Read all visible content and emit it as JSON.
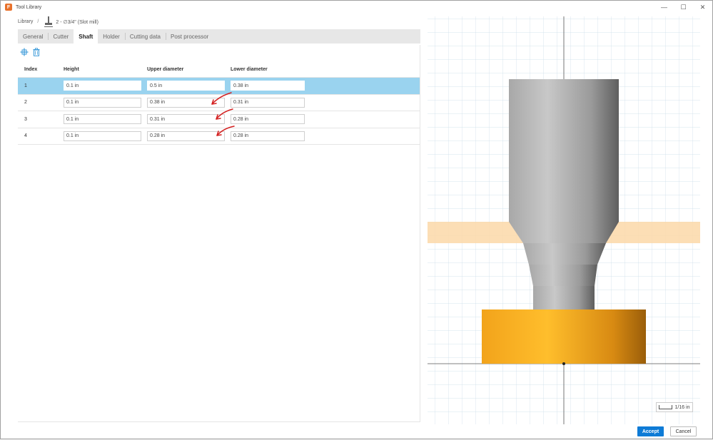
{
  "window": {
    "title": "Tool Library",
    "icon": "fusion-app-icon"
  },
  "breadcrumb": {
    "root": "Library",
    "separator": "/",
    "tool_name": "2 - ∅3/4\" (Slot mill)"
  },
  "tabs": [
    {
      "label": "General",
      "active": false
    },
    {
      "label": "Cutter",
      "active": false
    },
    {
      "label": "Shaft",
      "active": true
    },
    {
      "label": "Holder",
      "active": false
    },
    {
      "label": "Cutting data",
      "active": false
    },
    {
      "label": "Post processor",
      "active": false
    }
  ],
  "toolbar": {
    "add_icon": "add-segment-icon",
    "delete_icon": "trash-icon"
  },
  "table": {
    "headers": {
      "index": "Index",
      "height": "Height",
      "upper": "Upper diameter",
      "lower": "Lower diameter"
    },
    "rows": [
      {
        "index": "1",
        "height": "0.1 in",
        "upper": "0.5 in",
        "lower": "0.38 in",
        "selected": true
      },
      {
        "index": "2",
        "height": "0.1 in",
        "upper": "0.38 in",
        "lower": "0.31 in",
        "selected": false
      },
      {
        "index": "3",
        "height": "0.1 in",
        "upper": "0.31 in",
        "lower": "0.28 in",
        "selected": false
      },
      {
        "index": "4",
        "height": "0.1 in",
        "upper": "0.28 in",
        "lower": "0.28 in",
        "selected": false
      }
    ]
  },
  "viewport": {
    "scale_label": "1/16 in",
    "colors": {
      "shaft": "#9a9a9a",
      "cutter": "#f2a31b",
      "highlight_band": "#fbd8a8",
      "grid": "#c9dbe8"
    }
  },
  "footer": {
    "accept_label": "Accept",
    "cancel_label": "Cancel"
  },
  "colors": {
    "selection": "#9ad3ef",
    "accent": "#0e7bd6",
    "annotation_arrow": "#d42020"
  }
}
